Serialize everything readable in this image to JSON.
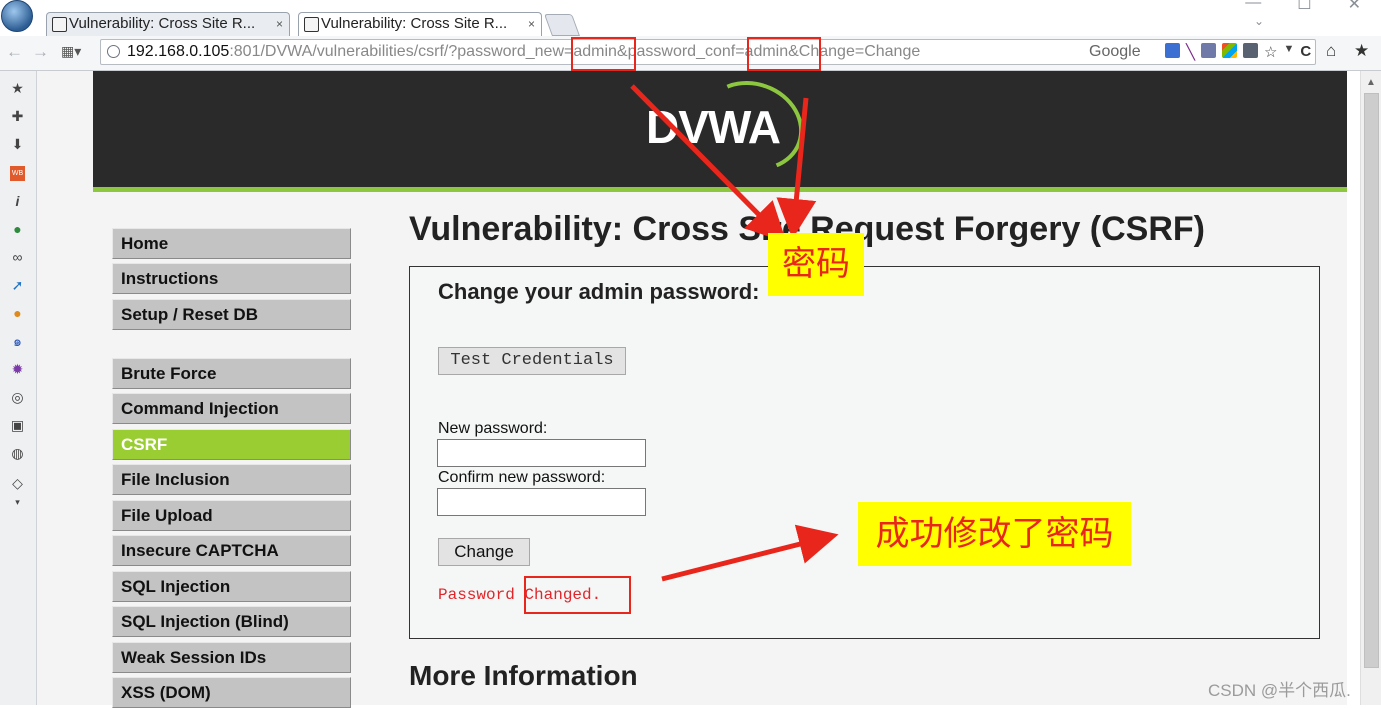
{
  "browser": {
    "tabs": [
      {
        "title": "Vulnerability: Cross Site R...",
        "close": "×",
        "active": false
      },
      {
        "title": "Vulnerability: Cross Site R...",
        "close": "×",
        "active": true
      }
    ],
    "url": {
      "host": "192.168.0.105",
      "rest": ":801/DVWA/vulnerabilities/csrf/?password_new=admin&password_conf=admin&Change=Change"
    },
    "search_engine": "Google",
    "controls": {
      "minimize": "—",
      "maximize": "☐",
      "close": "✕"
    }
  },
  "header": {
    "logo": "DVWA",
    "brand_color": "#8dc63f"
  },
  "menu": {
    "group1": [
      "Home",
      "Instructions",
      "Setup / Reset DB"
    ],
    "group2": [
      "Brute Force",
      "Command Injection",
      "CSRF",
      "File Inclusion",
      "File Upload",
      "Insecure CAPTCHA",
      "SQL Injection",
      "SQL Injection (Blind)",
      "Weak Session IDs",
      "XSS (DOM)"
    ],
    "selected": "CSRF"
  },
  "content": {
    "title": "Vulnerability: Cross Site Request Forgery (CSRF)",
    "box_title": "Change your admin password:",
    "test_button": "Test Credentials",
    "new_password_label": "New password:",
    "confirm_password_label": "Confirm new password:",
    "change_button": "Change",
    "result": "Password Changed.",
    "more_info": "More Information"
  },
  "annotations": {
    "password_callout": "密码",
    "success_callout": "成功修改了密码",
    "accent_color": "#e8261c",
    "callout_bg": "#ffff00"
  },
  "watermark": "CSDN @半个西瓜."
}
